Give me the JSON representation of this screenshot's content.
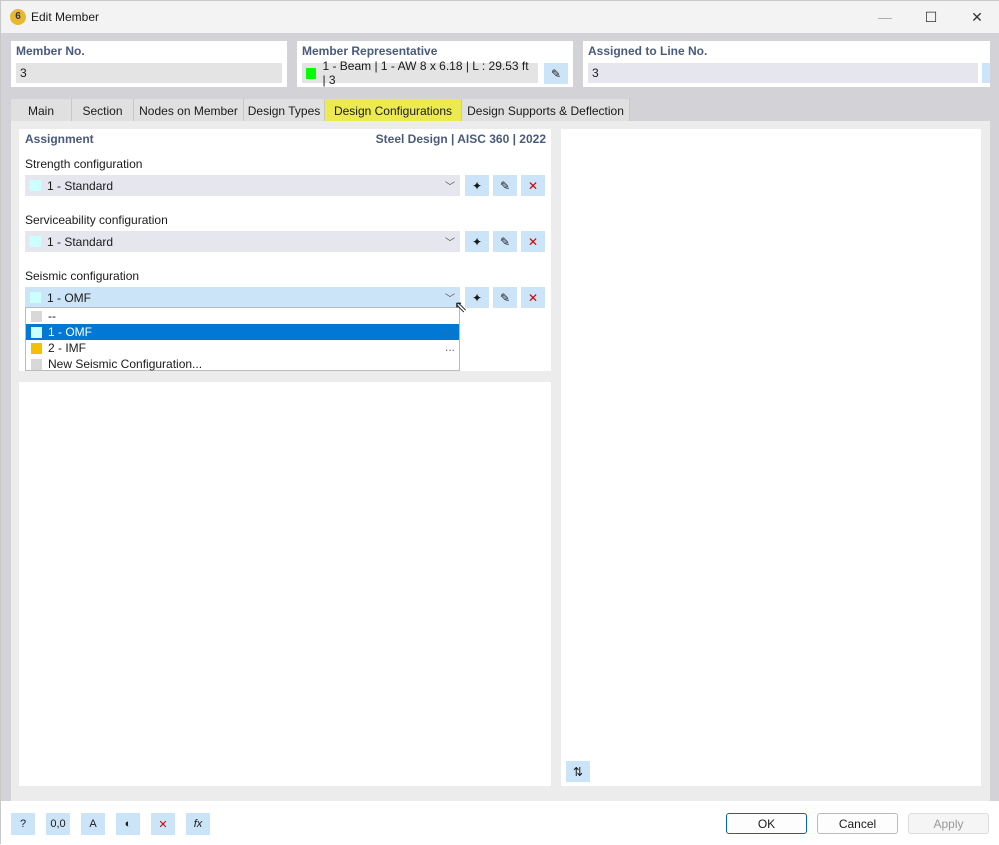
{
  "window": {
    "title": "Edit Member",
    "minimize": "—",
    "maximize": "☐",
    "close": "✕"
  },
  "header": {
    "member_no": {
      "label": "Member No.",
      "value": "3"
    },
    "member_rep": {
      "label": "Member Representative",
      "value": "1 - Beam | 1 - AW 8 x 6.18 | L : 29.53 ft | 3",
      "color": "#00ff00"
    },
    "assigned": {
      "label": "Assigned to Line No.",
      "value": "3"
    }
  },
  "tabs": [
    {
      "label": "Main"
    },
    {
      "label": "Section"
    },
    {
      "label": "Nodes on Member"
    },
    {
      "label": "Design Types"
    },
    {
      "label": "Design Configurations",
      "active": true
    },
    {
      "label": "Design Supports & Deflection"
    }
  ],
  "assignment": {
    "title": "Assignment",
    "standard": "Steel Design | AISC 360 | 2022",
    "strength": {
      "label": "Strength configuration",
      "value": "1 - Standard",
      "color": "#ccffff"
    },
    "serviceability": {
      "label": "Serviceability configuration",
      "value": "1 - Standard",
      "color": "#ccffff"
    },
    "seismic": {
      "label": "Seismic configuration",
      "value": "1 - OMF",
      "color": "#ccffff"
    },
    "dropdown": [
      {
        "label": "--",
        "color": "#d8d8d8"
      },
      {
        "label": "1 - OMF",
        "color": "#ccffff",
        "selected": true,
        "dots": "..."
      },
      {
        "label": "2 - IMF",
        "color": "#f5c000",
        "dots": "..."
      },
      {
        "label": "New Seismic Configuration...",
        "color": "#d8d8d8"
      }
    ]
  },
  "footer": {
    "ok": "OK",
    "cancel": "Cancel",
    "apply": "Apply"
  }
}
